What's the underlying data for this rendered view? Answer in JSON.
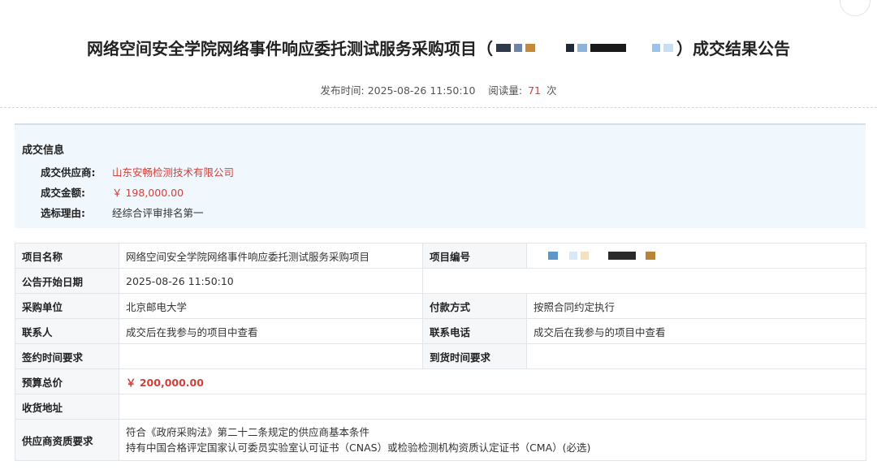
{
  "header": {
    "title_prefix": "网络空间安全学院网络事件响应委托测试服务采购项目（",
    "title_suffix": "）成交结果公告",
    "publish_label": "发布时间:",
    "publish_time": "2025-08-26 11:50:10",
    "views_label": "阅读量:",
    "views_count": "71",
    "views_unit": "次"
  },
  "deal": {
    "section_title": "成交信息",
    "supplier_label": "成交供应商:",
    "supplier_value": "山东安畅检测技术有限公司",
    "amount_label": "成交金额:",
    "amount_value": "￥ 198,000.00",
    "reason_label": "选标理由:",
    "reason_value": "经综合评审排名第一"
  },
  "project": {
    "name_label": "项目名称",
    "name_value": "网络空间安全学院网络事件响应委托测试服务采购项目",
    "code_label": "项目编号",
    "start_label": "公告开始日期",
    "start_value": "2025-08-26 11:50:10",
    "buyer_label": "采购单位",
    "buyer_value": "北京邮电大学",
    "payment_label": "付款方式",
    "payment_value": "按照合同约定执行",
    "contact_label": "联系人",
    "contact_value": "成交后在我参与的项目中查看",
    "phone_label": "联系电话",
    "phone_value": "成交后在我参与的项目中查看",
    "sign_label": "签约时间要求",
    "sign_value": "",
    "delivery_label": "到货时间要求",
    "delivery_value": "",
    "budget_label": "预算总价",
    "budget_value": "￥ 200,000.00",
    "address_label": "收货地址",
    "address_value": "",
    "qual_label": "供应商资质要求",
    "qual_line1": "符合《政府采购法》第二十二条规定的供应商基本条件",
    "qual_line2": "持有中国合格评定国家认可委员实验室认可证书（CNAS）或检验检测机构资质认定证书（CMA）(必选)"
  },
  "colors": {
    "accent_red": "#d0413c",
    "deal_bg": "#f0f7fd",
    "label_bg": "#f5f7f9"
  }
}
